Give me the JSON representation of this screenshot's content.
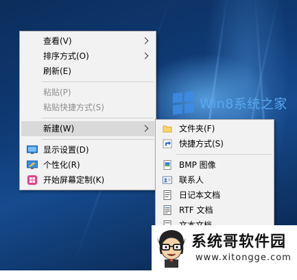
{
  "wallpaper": {
    "brand_text": "Win8系统之家",
    "accent": "#1b5fae"
  },
  "menu": {
    "items": [
      {
        "label": "查看(V)",
        "has_submenu": true
      },
      {
        "label": "排序方式(O)",
        "has_submenu": true
      },
      {
        "label": "刷新(E)"
      },
      {
        "label": "粘贴(P)",
        "disabled": true
      },
      {
        "label": "粘贴快捷方式(S)",
        "disabled": true
      },
      {
        "label": "新建(W)",
        "has_submenu": true,
        "highlighted": true
      },
      {
        "label": "显示设置(D)",
        "icon": "display-settings-icon"
      },
      {
        "label": "个性化(R)",
        "icon": "personalize-icon"
      },
      {
        "label": "开始屏幕定制(K)",
        "icon": "start-customize-icon"
      }
    ]
  },
  "submenu": {
    "items": [
      {
        "label": "文件夹(F)",
        "icon": "folder-icon"
      },
      {
        "label": "快捷方式(S)",
        "icon": "shortcut-icon"
      },
      {
        "label": "BMP 图像",
        "icon": "bmp-image-icon"
      },
      {
        "label": "联系人",
        "icon": "contact-icon"
      },
      {
        "label": "日记本文档",
        "icon": "journal-icon"
      },
      {
        "label": "RTF 文档",
        "icon": "rtf-document-icon"
      },
      {
        "label": "文本文档",
        "icon": "text-document-icon"
      }
    ]
  },
  "watermark": {
    "title": "系统哥软件园",
    "url": "www.xitongge.com"
  }
}
